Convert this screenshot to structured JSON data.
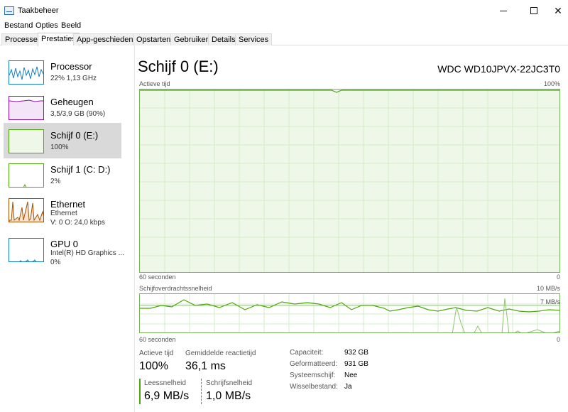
{
  "window": {
    "title": "Taakbeheer"
  },
  "menu": {
    "items": [
      "Bestand",
      "Opties",
      "Beeld"
    ]
  },
  "tabs": [
    {
      "label": "Processen"
    },
    {
      "label": "Prestaties"
    },
    {
      "label": "App-geschiedenis"
    },
    {
      "label": "Opstarten"
    },
    {
      "label": "Gebruikers"
    },
    {
      "label": "Details"
    },
    {
      "label": "Services"
    }
  ],
  "sidebar": {
    "items": [
      {
        "title": "Processor",
        "lines": [
          "22%  1,13 GHz"
        ],
        "color": "#117dbb"
      },
      {
        "title": "Geheugen",
        "lines": [
          "3,5/3,9 GB (90%)"
        ],
        "color": "#8b12ae"
      },
      {
        "title": "Schijf 0 (E:)",
        "lines": [
          "100%"
        ],
        "color": "#4da60c"
      },
      {
        "title": "Schijf 1 (C: D:)",
        "lines": [
          "2%"
        ],
        "color": "#4da60c"
      },
      {
        "title": "Ethernet",
        "lines": [
          "Ethernet",
          "V: 0  O: 24,0 kbps"
        ],
        "color": "#a74f01"
      },
      {
        "title": "GPU 0",
        "lines": [
          "Intel(R) HD Graphics ...",
          "0%"
        ],
        "color": "#117dbb"
      }
    ]
  },
  "main": {
    "title": "Schijf 0 (E:)",
    "model": "WDC WD10JPVX-22JC3T0",
    "graph1": {
      "label": "Actieve tijd",
      "max": "100%",
      "xlabel": "60 seconden",
      "min": "0"
    },
    "graph2": {
      "label": "Schijfoverdrachtssnelheid",
      "max": "10 MB/s",
      "line": "7 MB/s",
      "xlabel": "60 seconden",
      "min": "0"
    },
    "stats": {
      "active_label": "Actieve tijd",
      "active_value": "100%",
      "response_label": "Gemiddelde reactietijd",
      "response_value": "36,1 ms",
      "read_label": "Leessnelheid",
      "read_value": "6,9 MB/s",
      "write_label": "Schrijfsnelheid",
      "write_value": "1,0 MB/s"
    },
    "info": [
      {
        "label": "Capaciteit:",
        "value": "932 GB"
      },
      {
        "label": "Geformatteerd:",
        "value": "931 GB"
      },
      {
        "label": "Systeemschijf:",
        "value": "Nee"
      },
      {
        "label": "Wisselbestand:",
        "value": "Ja"
      }
    ]
  },
  "colors": {
    "accent_green": "#4da60c",
    "grid_green": "#d6ecc9",
    "graph_border": "#79b15c"
  }
}
